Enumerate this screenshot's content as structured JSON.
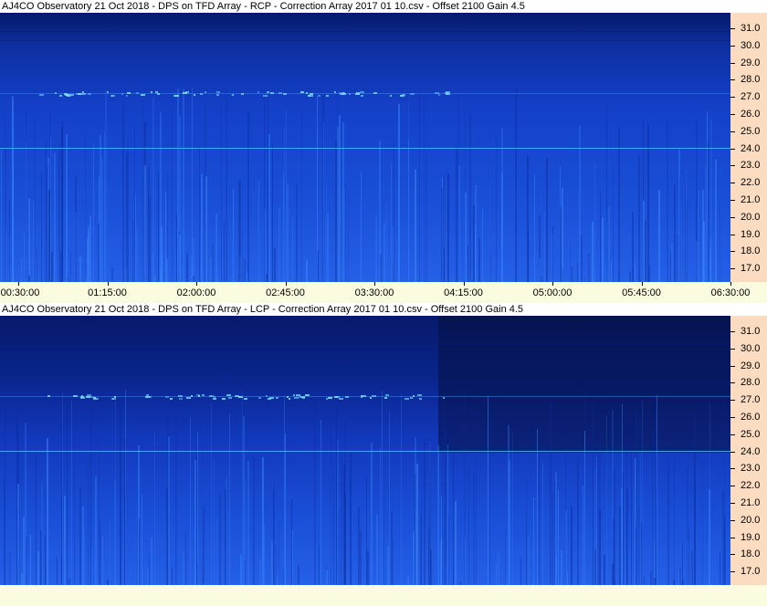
{
  "panels": [
    {
      "title": "AJ4CO Observatory 21 Oct 2018  -  DPS on TFD Array  -  RCP  -  Correction Array 2017 01 10.csv  -  Offset 2100  Gain 4.5",
      "polarization": "RCP"
    },
    {
      "title": "AJ4CO Observatory 21 Oct 2018  -  DPS on TFD Array  -  LCP  -  Correction Array 2017 01 10.csv  -  Offset 2100  Gain 4.5",
      "polarization": "LCP"
    }
  ],
  "freq_labels": [
    "31.0",
    "30.0",
    "29.0",
    "28.0",
    "27.0",
    "26.0",
    "25.0",
    "24.0",
    "23.0",
    "22.0",
    "21.0",
    "20.0",
    "19.0",
    "18.0",
    "17.0"
  ],
  "time_labels": [
    "00:30:00",
    "01:15:00",
    "02:00:00",
    "02:45:00",
    "03:30:00",
    "04:15:00",
    "05:00:00",
    "05:45:00",
    "06:30:00"
  ],
  "colors": {
    "spectro_base": "#1a4fd8",
    "spectro_dark": "#061a6a",
    "spectro_light": "#3a8cff",
    "axis_bg": "#fbdcc0",
    "time_bg": "#fbfbe0"
  }
}
